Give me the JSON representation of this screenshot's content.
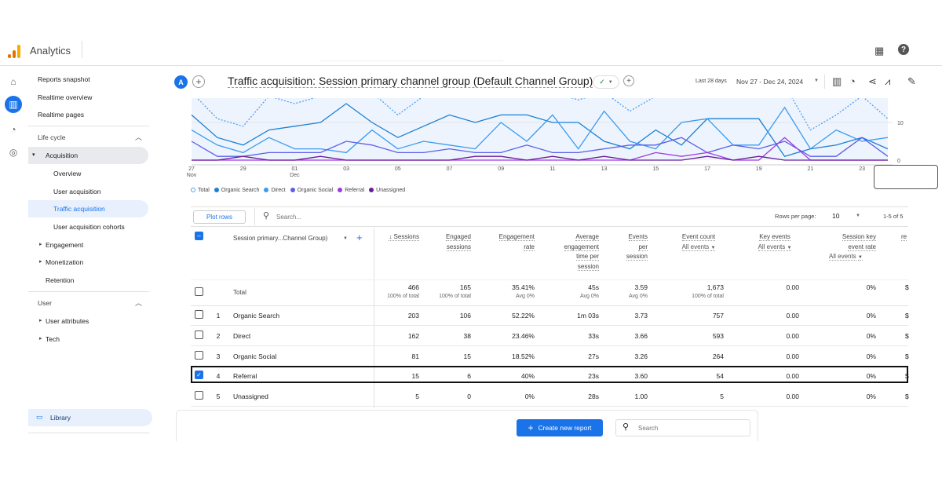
{
  "app": {
    "name": "Analytics"
  },
  "header": {
    "account_initial": "A",
    "title": "Traffic acquisition: Session primary channel group (Default Channel Group)",
    "date_label": "Last 28 days",
    "date_range": "Nov 27 - Dec 24, 2024"
  },
  "sidebar": {
    "top_items": [
      {
        "label": "Reports snapshot"
      },
      {
        "label": "Realtime overview"
      },
      {
        "label": "Realtime pages"
      }
    ],
    "lifecycle": {
      "label": "Life cycle",
      "acquisition": "Acquisition",
      "acq_items": [
        {
          "label": "Overview"
        },
        {
          "label": "User acquisition"
        },
        {
          "label": "Traffic acquisition"
        },
        {
          "label": "User acquisition cohorts"
        }
      ],
      "others": [
        {
          "label": "Engagement"
        },
        {
          "label": "Monetization"
        },
        {
          "label": "Retention"
        }
      ]
    },
    "user": {
      "label": "User",
      "items": [
        {
          "label": "User attributes"
        },
        {
          "label": "Tech"
        }
      ]
    },
    "library": "Library"
  },
  "chart_data": {
    "type": "line",
    "x_ticks": [
      {
        "day": "27",
        "month": "Nov"
      },
      {
        "day": "29"
      },
      {
        "day": "01",
        "month": "Dec"
      },
      {
        "day": "03"
      },
      {
        "day": "05"
      },
      {
        "day": "07"
      },
      {
        "day": "09"
      },
      {
        "day": "11"
      },
      {
        "day": "13"
      },
      {
        "day": "15"
      },
      {
        "day": "17"
      },
      {
        "day": "19"
      },
      {
        "day": "21"
      },
      {
        "day": "23"
      }
    ],
    "y_ticks": [
      "10",
      "0"
    ],
    "x": [
      "Nov 27",
      "Nov 28",
      "Nov 29",
      "Nov 30",
      "Dec 01",
      "Dec 02",
      "Dec 03",
      "Dec 04",
      "Dec 05",
      "Dec 06",
      "Dec 07",
      "Dec 08",
      "Dec 09",
      "Dec 10",
      "Dec 11",
      "Dec 12",
      "Dec 13",
      "Dec 14",
      "Dec 15",
      "Dec 16",
      "Dec 17",
      "Dec 18",
      "Dec 19",
      "Dec 20",
      "Dec 21",
      "Dec 22",
      "Dec 23",
      "Dec 24"
    ],
    "series": [
      {
        "name": "Total",
        "color": "#4a9ff5",
        "dashed": true,
        "values": [
          18,
          11,
          9,
          17,
          15,
          17,
          20,
          18,
          12,
          17,
          19,
          20,
          19,
          20,
          18,
          16,
          18,
          13,
          17,
          19,
          20,
          19,
          18,
          20,
          8,
          12,
          17,
          11
        ]
      },
      {
        "name": "Organic Search",
        "color": "#1a7fd4",
        "values": [
          12,
          6,
          4,
          8,
          9,
          10,
          15,
          10,
          6,
          9,
          12,
          10,
          12,
          12,
          10,
          10,
          5,
          3,
          8,
          4,
          11,
          11,
          11,
          1,
          3,
          4,
          6,
          3
        ]
      },
      {
        "name": "Direct",
        "color": "#3a9bf0",
        "values": [
          8,
          4,
          2,
          6,
          3,
          3,
          2,
          8,
          3,
          5,
          4,
          3,
          10,
          5,
          12,
          3,
          13,
          5,
          3,
          10,
          11,
          4,
          4,
          14,
          3,
          8,
          5,
          6
        ]
      },
      {
        "name": "Organic Social",
        "color": "#5b5fe8",
        "values": [
          5,
          1,
          1,
          2,
          2,
          2,
          5,
          4,
          2,
          2,
          3,
          2,
          2,
          4,
          2,
          2,
          3,
          4,
          4,
          6,
          2,
          4,
          3,
          5,
          1,
          1,
          6,
          1
        ]
      },
      {
        "name": "Referral",
        "color": "#9b3be0",
        "values": [
          0,
          0,
          0,
          0,
          0,
          0,
          0,
          0,
          0,
          0,
          0,
          0,
          0,
          0,
          0,
          0,
          0,
          0,
          2,
          1,
          2,
          0,
          0,
          6,
          0,
          0,
          0,
          0
        ]
      },
      {
        "name": "Unassigned",
        "color": "#6a1b9a",
        "values": [
          0,
          0,
          1,
          0,
          0,
          1,
          0,
          0,
          0,
          0,
          0,
          1,
          1,
          0,
          1,
          0,
          1,
          0,
          0,
          0,
          1,
          0,
          1,
          0,
          0,
          0,
          0,
          0
        ]
      }
    ],
    "ylim": [
      0,
      16
    ]
  },
  "table": {
    "plot_rows": "Plot rows",
    "search_placeholder": "Search...",
    "rows_per_page_label": "Rows per page:",
    "rows_per_page": "10",
    "pagination": "1-5 of 5",
    "dimension_header": "Session primary...Channel Group)",
    "columns": [
      {
        "lines": [
          "↓ Sessions"
        ]
      },
      {
        "lines": [
          "Engaged",
          "sessions"
        ]
      },
      {
        "lines": [
          "Engagement",
          "rate"
        ]
      },
      {
        "lines": [
          "Average",
          "engagement",
          "time per",
          "session"
        ]
      },
      {
        "lines": [
          "Events",
          "per",
          "session"
        ]
      },
      {
        "lines": [
          "Event count"
        ],
        "filter": "All events"
      },
      {
        "lines": [
          "Key events"
        ],
        "filter": "All events"
      },
      {
        "lines": [
          "Session key",
          "event rate"
        ],
        "filter": "All events"
      },
      {
        "lines": [
          "re"
        ]
      }
    ],
    "total": {
      "label": "Total",
      "values": [
        "466",
        "165",
        "35.41%",
        "45s",
        "3.59",
        "1,673",
        "0.00",
        "0%",
        "$"
      ],
      "subs": [
        "100% of total",
        "100% of total",
        "Avg 0%",
        "Avg 0%",
        "Avg 0%",
        "100% of total",
        "",
        "",
        ""
      ]
    },
    "rows": [
      {
        "num": "1",
        "name": "Organic Search",
        "values": [
          "203",
          "106",
          "52.22%",
          "1m 03s",
          "3.73",
          "757",
          "0.00",
          "0%",
          "$"
        ],
        "checked": false
      },
      {
        "num": "2",
        "name": "Direct",
        "values": [
          "162",
          "38",
          "23.46%",
          "33s",
          "3.66",
          "593",
          "0.00",
          "0%",
          "$"
        ],
        "checked": false
      },
      {
        "num": "3",
        "name": "Organic Social",
        "values": [
          "81",
          "15",
          "18.52%",
          "27s",
          "3.26",
          "264",
          "0.00",
          "0%",
          "$"
        ],
        "checked": false
      },
      {
        "num": "4",
        "name": "Referral",
        "values": [
          "15",
          "6",
          "40%",
          "23s",
          "3.60",
          "54",
          "0.00",
          "0%",
          "$"
        ],
        "checked": true
      },
      {
        "num": "5",
        "name": "Unassigned",
        "values": [
          "5",
          "0",
          "0%",
          "28s",
          "1.00",
          "5",
          "0.00",
          "0%",
          "$"
        ],
        "checked": false
      }
    ]
  },
  "footer": {
    "create_report": "Create new report",
    "search_placeholder": "Search"
  }
}
